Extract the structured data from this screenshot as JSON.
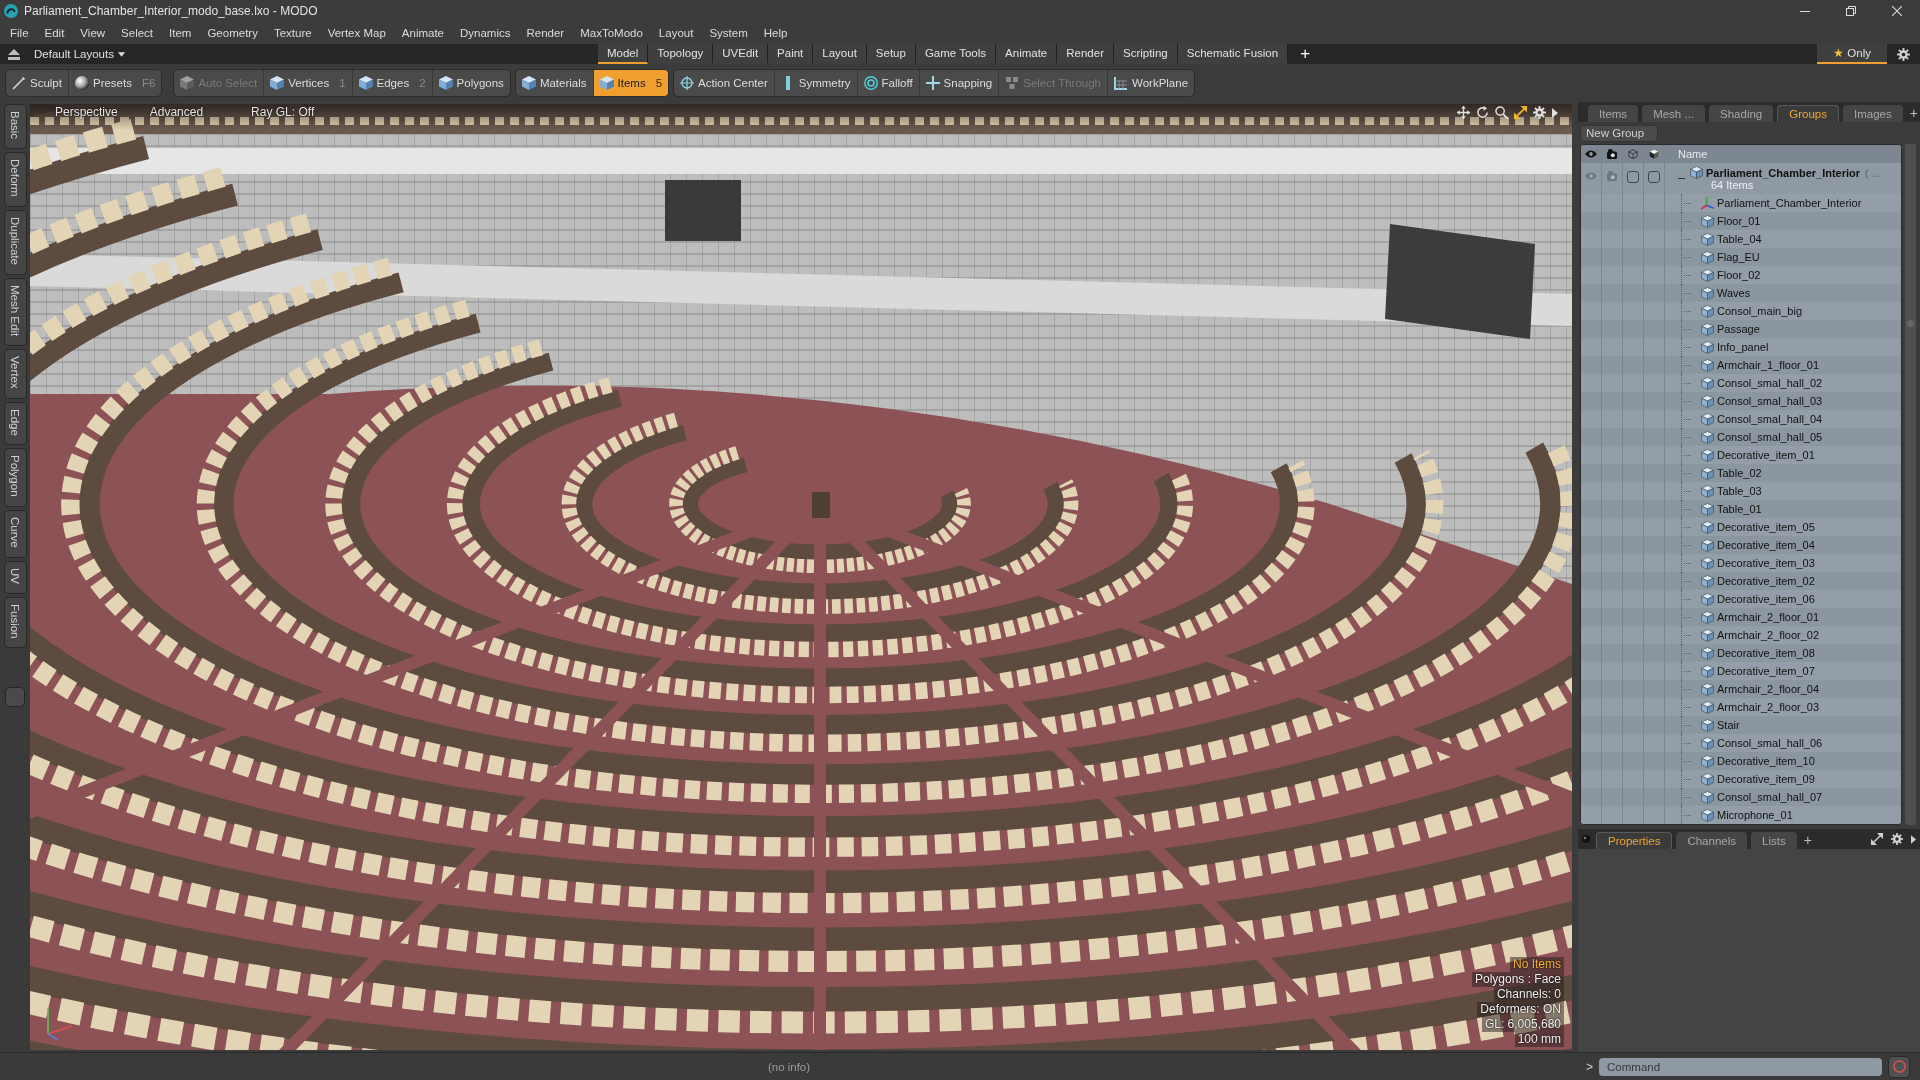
{
  "window": {
    "title": "Parliament_Chamber_Interior_modo_base.lxo - MODO"
  },
  "menu": [
    "File",
    "Edit",
    "View",
    "Select",
    "Item",
    "Geometry",
    "Texture",
    "Vertex Map",
    "Animate",
    "Dynamics",
    "Render",
    "MaxToModo",
    "Layout",
    "System",
    "Help"
  ],
  "layouts": {
    "preset": "Default Layouts",
    "tabs": [
      {
        "label": "Model",
        "selected": true
      },
      {
        "label": "Topology",
        "selected": false
      },
      {
        "label": "UVEdit",
        "selected": false
      },
      {
        "label": "Paint",
        "selected": false
      },
      {
        "label": "Layout",
        "selected": false
      },
      {
        "label": "Setup",
        "selected": false
      },
      {
        "label": "Game Tools",
        "selected": false
      },
      {
        "label": "Animate",
        "selected": false
      },
      {
        "label": "Render",
        "selected": false
      },
      {
        "label": "Scripting",
        "selected": false
      },
      {
        "label": "Schematic Fusion",
        "selected": false
      }
    ],
    "add": "+",
    "filter": {
      "symbol": "★",
      "label": "Only",
      "selected": true
    }
  },
  "toolbar": [
    {
      "tools": [
        {
          "label": "Sculpt",
          "selected": false,
          "disabled": false
        },
        {
          "label": "Presets",
          "shortcut": "F6",
          "selected": false,
          "disabled": false
        }
      ]
    },
    {
      "tools": [
        {
          "label": "Auto Select",
          "selected": false,
          "disabled": true
        },
        {
          "label": "Vertices",
          "shortcut": "1",
          "selected": false,
          "disabled": false
        },
        {
          "label": "Edges",
          "shortcut": "2",
          "selected": false,
          "disabled": false
        },
        {
          "label": "Polygons",
          "selected": false,
          "disabled": false
        }
      ]
    },
    {
      "tools": [
        {
          "label": "Materials",
          "selected": false,
          "disabled": false
        },
        {
          "label": "Items",
          "shortcut": "5",
          "selected": true,
          "disabled": false
        }
      ]
    },
    {
      "tools": [
        {
          "label": "Action Center",
          "selected": false,
          "disabled": false
        },
        {
          "label": "Symmetry",
          "selected": false,
          "disabled": false
        },
        {
          "label": "Falloff",
          "selected": false,
          "disabled": false
        },
        {
          "label": "Snapping",
          "selected": false,
          "disabled": false
        },
        {
          "label": "Select Through",
          "selected": false,
          "disabled": true
        },
        {
          "label": "WorkPlane",
          "selected": false,
          "disabled": false
        }
      ]
    }
  ],
  "toolbox_tabs": [
    {
      "label": "Basic",
      "selected": false
    },
    {
      "label": "Deform",
      "selected": false
    },
    {
      "label": "Duplicate",
      "selected": false
    },
    {
      "label": "Mesh Edit",
      "selected": false
    },
    {
      "label": "Vertex",
      "selected": false
    },
    {
      "label": "Edge",
      "selected": false
    },
    {
      "label": "Polygon",
      "selected": false
    },
    {
      "label": "Curve",
      "selected": false
    },
    {
      "label": "UV",
      "selected": false
    },
    {
      "label": "Fusion",
      "selected": false
    }
  ],
  "viewport": {
    "view": "Perspective",
    "shading": "Advanced",
    "ray_gl": "Ray GL: Off",
    "info": [
      {
        "text": "No Items",
        "kind": "notice"
      },
      {
        "text": "Polygons : Face",
        "kind": "stat"
      },
      {
        "text": "Channels: 0",
        "kind": "stat"
      },
      {
        "text": "Deformers: ON",
        "kind": "stat"
      },
      {
        "text": "GL: 6,005,680",
        "kind": "stat"
      },
      {
        "text": "100 mm",
        "kind": "stat"
      }
    ]
  },
  "item_panel": {
    "tabs": [
      {
        "label": "Items",
        "selected": false
      },
      {
        "label": "Mesh ...",
        "selected": false
      },
      {
        "label": "Shading",
        "selected": false
      },
      {
        "label": "Groups",
        "selected": true
      },
      {
        "label": "Images",
        "selected": false
      }
    ],
    "add": "+",
    "new_group": "New Group",
    "column_name": "Name",
    "groups": [
      {
        "name": "Parliament_Chamber_Interior",
        "suffix": "( ...",
        "count": "64 Items",
        "expanded": true,
        "visible": true,
        "render": true,
        "locked": false,
        "select_locked": false,
        "children": [
          {
            "name": "Parliament_Chamber_Interior",
            "kind": "locator"
          },
          {
            "name": "Floor_01",
            "kind": "mesh"
          },
          {
            "name": "Table_04",
            "kind": "mesh"
          },
          {
            "name": "Flag_EU",
            "kind": "mesh"
          },
          {
            "name": "Floor_02",
            "kind": "mesh"
          },
          {
            "name": "Waves",
            "kind": "mesh"
          },
          {
            "name": "Consol_main_big",
            "kind": "mesh"
          },
          {
            "name": "Passage",
            "kind": "mesh"
          },
          {
            "name": "Info_panel",
            "kind": "mesh"
          },
          {
            "name": "Armchair_1_floor_01",
            "kind": "mesh"
          },
          {
            "name": "Consol_smal_hall_02",
            "kind": "mesh"
          },
          {
            "name": "Consol_smal_hall_03",
            "kind": "mesh"
          },
          {
            "name": "Consol_smal_hall_04",
            "kind": "mesh"
          },
          {
            "name": "Consol_smal_hall_05",
            "kind": "mesh"
          },
          {
            "name": "Decorative_item_01",
            "kind": "mesh"
          },
          {
            "name": "Table_02",
            "kind": "mesh"
          },
          {
            "name": "Table_03",
            "kind": "mesh"
          },
          {
            "name": "Table_01",
            "kind": "mesh"
          },
          {
            "name": "Decorative_item_05",
            "kind": "mesh"
          },
          {
            "name": "Decorative_item_04",
            "kind": "mesh"
          },
          {
            "name": "Decorative_item_03",
            "kind": "mesh"
          },
          {
            "name": "Decorative_item_02",
            "kind": "mesh"
          },
          {
            "name": "Decorative_item_06",
            "kind": "mesh"
          },
          {
            "name": "Armchair_2_floor_01",
            "kind": "mesh"
          },
          {
            "name": "Armchair_2_floor_02",
            "kind": "mesh"
          },
          {
            "name": "Decorative_item_08",
            "kind": "mesh"
          },
          {
            "name": "Decorative_item_07",
            "kind": "mesh"
          },
          {
            "name": "Armchair_2_floor_04",
            "kind": "mesh"
          },
          {
            "name": "Armchair_2_floor_03",
            "kind": "mesh"
          },
          {
            "name": "Stair",
            "kind": "mesh"
          },
          {
            "name": "Consol_smal_hall_06",
            "kind": "mesh"
          },
          {
            "name": "Decorative_item_10",
            "kind": "mesh"
          },
          {
            "name": "Decorative_item_09",
            "kind": "mesh"
          },
          {
            "name": "Consol_smal_hall_07",
            "kind": "mesh"
          },
          {
            "name": "Microphone_01",
            "kind": "mesh"
          }
        ]
      }
    ]
  },
  "properties_panel": {
    "tabs": [
      {
        "label": "Properties",
        "selected": true
      },
      {
        "label": "Channels",
        "selected": false
      },
      {
        "label": "Lists",
        "selected": false
      }
    ],
    "add": "+"
  },
  "status_bar": {
    "text": "(no info)"
  },
  "command": {
    "prompt": ">",
    "placeholder": "Command"
  }
}
